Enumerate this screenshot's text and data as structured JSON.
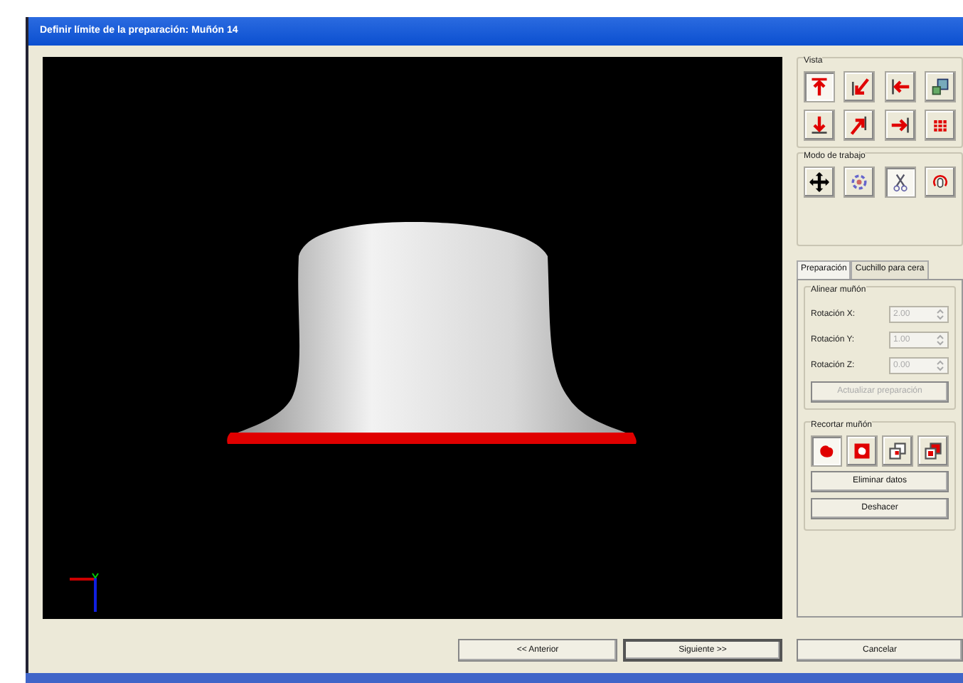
{
  "window": {
    "title": "Definir límite de la preparación: Muñón 14"
  },
  "view": {
    "title": "Vista",
    "buttons": [
      {
        "kind": "up",
        "selected": true
      },
      {
        "kind": "diagleft",
        "selected": false
      },
      {
        "kind": "left",
        "selected": false
      },
      {
        "kind": "cube",
        "selected": false
      },
      {
        "kind": "down",
        "selected": false
      },
      {
        "kind": "diagright",
        "selected": false
      },
      {
        "kind": "right",
        "selected": false
      },
      {
        "kind": "grid",
        "selected": false
      }
    ]
  },
  "work_mode": {
    "title": "Modo de trabajo",
    "buttons": [
      {
        "kind": "move",
        "selected": false
      },
      {
        "kind": "rotate",
        "selected": false
      },
      {
        "kind": "scissors",
        "selected": true
      },
      {
        "kind": "flip",
        "selected": false
      }
    ]
  },
  "tabs": [
    {
      "label": "Preparación",
      "selected": true
    },
    {
      "label": "Cuchillo para cera",
      "selected": false
    }
  ],
  "align": {
    "title": "Alinear muñón",
    "fields": [
      {
        "label": "Rotación X:",
        "value": "2.00",
        "disabled": true
      },
      {
        "label": "Rotación Y:",
        "value": "1.00",
        "disabled": true
      },
      {
        "label": "Rotación Z:",
        "value": "0.00",
        "disabled": true
      }
    ],
    "update_button": {
      "label": "Actualizar preparación",
      "disabled": true
    }
  },
  "trim": {
    "title": "Recortar muñón",
    "tools": [
      {
        "kind": "blob",
        "selected": true
      },
      {
        "kind": "framed",
        "selected": false
      },
      {
        "kind": "overlap",
        "selected": false
      },
      {
        "kind": "overlapfill",
        "selected": false
      }
    ],
    "buttons": [
      "Eliminar datos",
      "Deshacer"
    ]
  },
  "footer": [
    {
      "label": "<< Anterior",
      "default": false
    },
    {
      "label": "Siguiente >>",
      "default": true
    },
    {
      "label": "Cancelar",
      "default": false
    }
  ]
}
